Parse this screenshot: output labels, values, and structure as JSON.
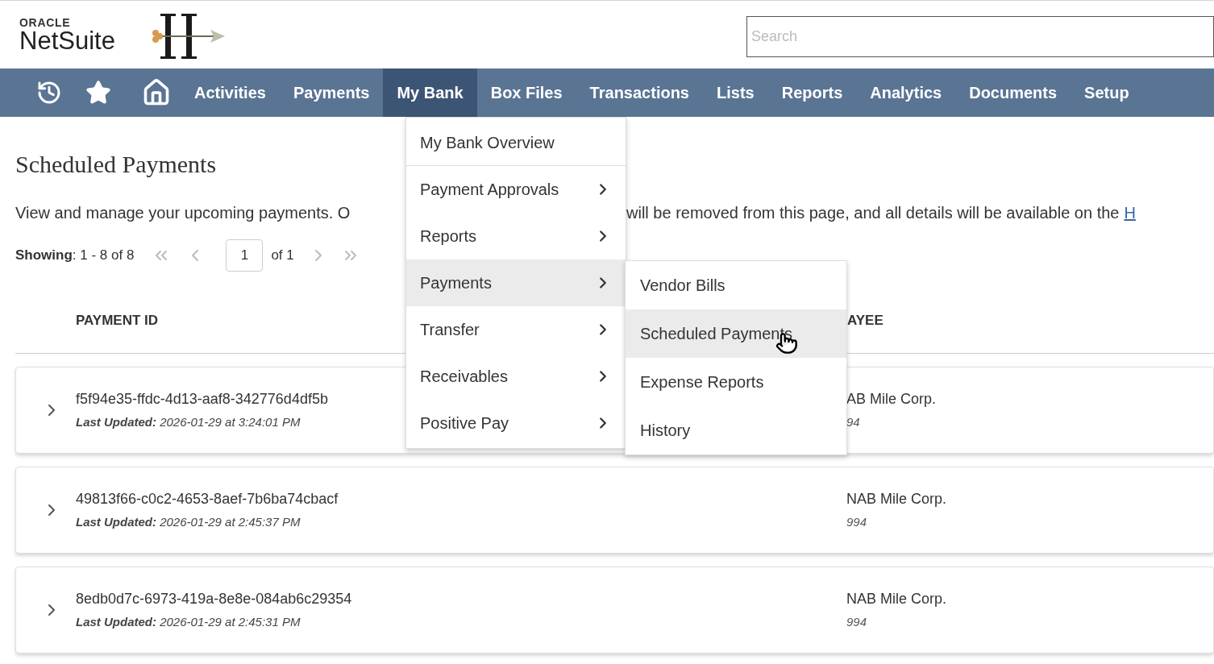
{
  "header": {
    "logo": {
      "brand": "ORACLE",
      "product": "NetSuite"
    },
    "search": {
      "placeholder": "Search"
    }
  },
  "nav": {
    "items": [
      {
        "label": "Activities",
        "selected": false
      },
      {
        "label": "Payments",
        "selected": false
      },
      {
        "label": "My Bank",
        "selected": true
      },
      {
        "label": "Box Files",
        "selected": false
      },
      {
        "label": "Transactions",
        "selected": false
      },
      {
        "label": "Lists",
        "selected": false
      },
      {
        "label": "Reports",
        "selected": false
      },
      {
        "label": "Analytics",
        "selected": false
      },
      {
        "label": "Documents",
        "selected": false
      },
      {
        "label": "Setup",
        "selected": false
      }
    ]
  },
  "menu": {
    "items": [
      {
        "label": "My Bank Overview",
        "has_submenu": false,
        "selected": false
      },
      {
        "label": "Payment Approvals",
        "has_submenu": true,
        "selected": false
      },
      {
        "label": "Reports",
        "has_submenu": true,
        "selected": false
      },
      {
        "label": "Payments",
        "has_submenu": true,
        "selected": true
      },
      {
        "label": "Transfer",
        "has_submenu": true,
        "selected": false
      },
      {
        "label": "Receivables",
        "has_submenu": true,
        "selected": false
      },
      {
        "label": "Positive Pay",
        "has_submenu": true,
        "selected": false
      }
    ]
  },
  "submenu": {
    "items": [
      {
        "label": "Vendor Bills",
        "selected": false
      },
      {
        "label": "Scheduled Payments",
        "selected": true
      },
      {
        "label": "Expense Reports",
        "selected": false
      },
      {
        "label": "History",
        "selected": false
      }
    ]
  },
  "page": {
    "title": "Scheduled Payments",
    "description_start": "View and manage your upcoming payments. O",
    "description_end": "will be removed from this page, and all details will be available on the",
    "description_link": "H"
  },
  "pagination": {
    "showing": "**Showing**: 1 - 8 of 8",
    "page": "1",
    "of": "of 1"
  },
  "columns": [
    "PAYMENT ID",
    "AYEE"
  ],
  "rows": [
    {
      "id": "f5f94e35-ffdc-4d13-aaf8-342776d4df5b",
      "updated": "**Last Updated:** 2026-01-29 at 3:24:01 PM",
      "payee": "AB Mile Corp.",
      "payee_number": "94"
    },
    {
      "id": "49813f66-c0c2-4653-8aef-7b6ba74cbacf",
      "updated": "**Last Updated:** 2026-01-29 at 2:45:37 PM",
      "payee": "NAB Mile Corp.",
      "payee_number": "994"
    },
    {
      "id": "8edb0d7c-6973-419a-8e8e-084ab6c29354",
      "updated": "**Last Updated:** 2026-01-29 at 2:45:31 PM",
      "payee": "NAB Mile Corp.",
      "payee_number": "994"
    }
  ]
}
